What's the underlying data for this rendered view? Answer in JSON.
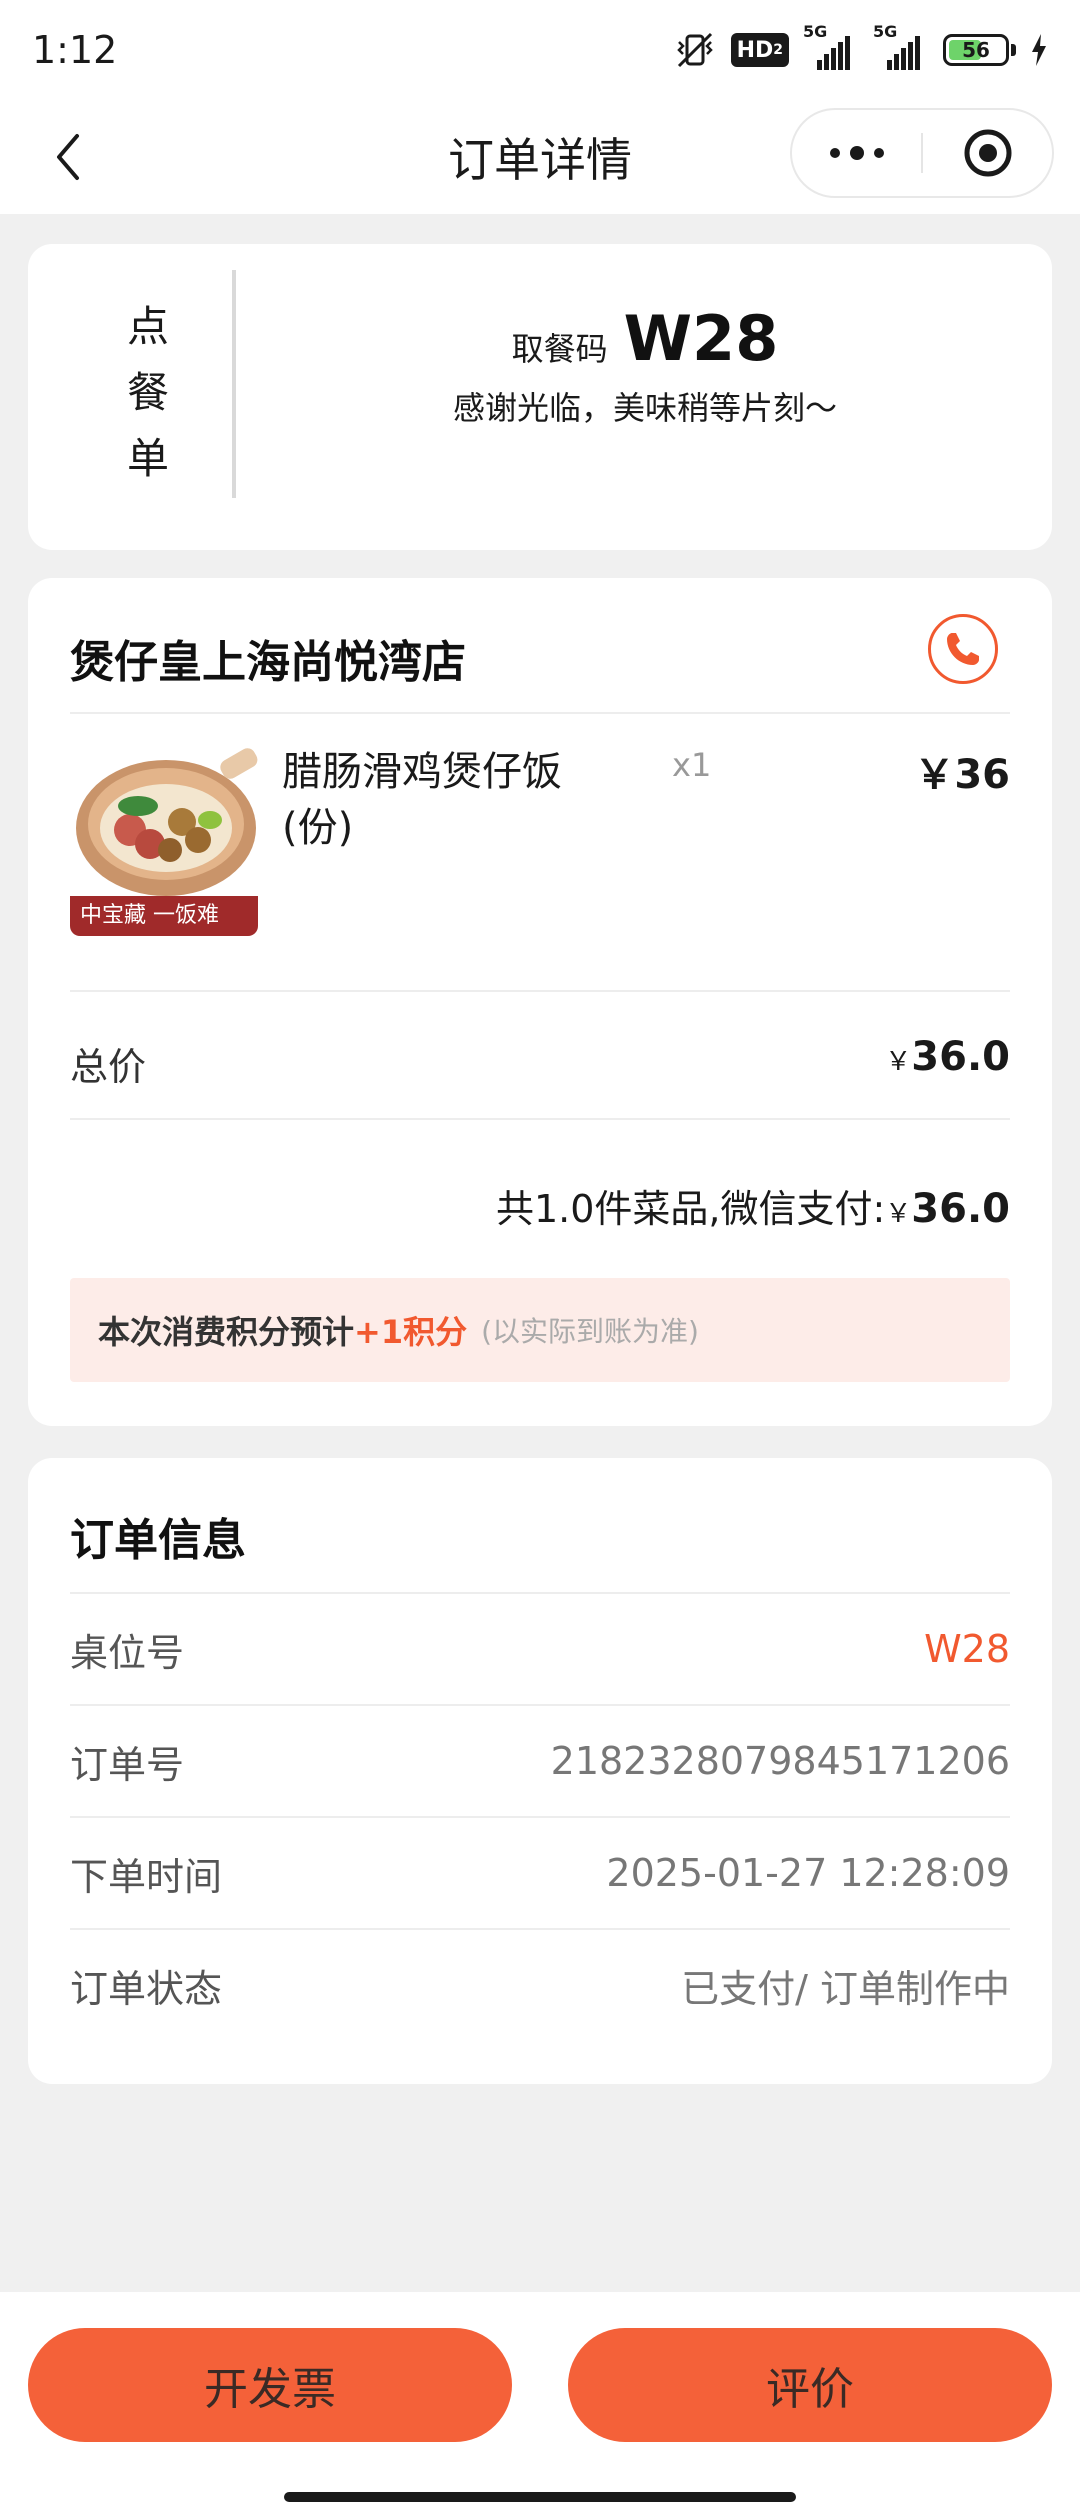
{
  "status_bar": {
    "time": "1:12",
    "hd_label": "HD",
    "hd_sub": "2",
    "net1": "5G",
    "net2": "5G",
    "battery": "56"
  },
  "nav": {
    "title": "订单详情"
  },
  "pickup": {
    "vertical_chars": [
      "点",
      "餐",
      "单"
    ],
    "code_label": "取餐码",
    "code": "W28",
    "thanks": "感谢光临，美味稍等片刻～"
  },
  "order": {
    "store_name": "煲仔皇上海尚悦湾店",
    "item": {
      "name": "腊肠滑鸡煲仔饭(份)",
      "qty": "x1",
      "price": "￥36",
      "banner_text": "中宝藏  一饭难"
    },
    "total_label": "总价",
    "total_currency": "￥",
    "total_value": "36.0",
    "summary_text": "共1.0件菜品,微信支付:",
    "summary_currency": "￥",
    "summary_value": "36.0",
    "points_text": "本次消费积分预计",
    "points_value": "+1积分",
    "points_note": "(以实际到账为准)"
  },
  "info": {
    "title": "订单信息",
    "rows": [
      {
        "label": "桌位号",
        "value": "W28"
      },
      {
        "label": "订单号",
        "value": "2182328079845171206"
      },
      {
        "label": "下单时间",
        "value": "2025-01-27 12:28:09"
      },
      {
        "label": "订单状态",
        "value": "已支付/ 订单制作中"
      }
    ]
  },
  "actions": {
    "invoice": "开发票",
    "review": "评价"
  },
  "colors": {
    "accent": "#f1592f",
    "button": "#f46139",
    "points_bg": "#fdece8",
    "page_bg": "#f0f0f0"
  }
}
